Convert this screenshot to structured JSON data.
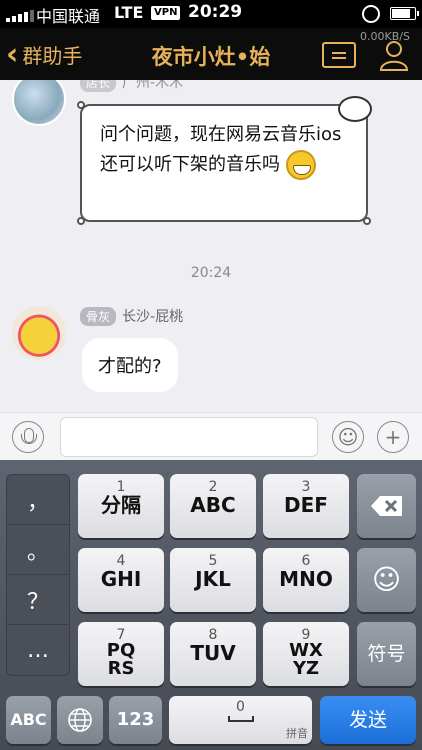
{
  "status": {
    "carrier": "中国联通",
    "network": "LTE",
    "vpn": "VPN",
    "time": "20:29",
    "speed": "0.00KB/S"
  },
  "nav": {
    "back_label": "群助手",
    "title": "夜市小灶•始"
  },
  "chat": {
    "msg1": {
      "sender_tag": "店长",
      "sender": "广州-木木",
      "text": "问个问题，现在网易云音乐ios还可以听下架的音乐吗"
    },
    "timestamp": "20:24",
    "msg2": {
      "sender_tag": "骨灰",
      "sender": "长沙-屁桃",
      "text": "才配的?"
    }
  },
  "input": {
    "placeholder": ""
  },
  "keyboard": {
    "side": [
      "，",
      "。",
      "？",
      "…"
    ],
    "keys": [
      {
        "num": "1",
        "label": "分隔"
      },
      {
        "num": "2",
        "label": "ABC"
      },
      {
        "num": "3",
        "label": "DEF"
      },
      {
        "num": "4",
        "label": "GHI"
      },
      {
        "num": "5",
        "label": "JKL"
      },
      {
        "num": "6",
        "label": "MNO"
      },
      {
        "num": "7",
        "label": "PQRS"
      },
      {
        "num": "8",
        "label": "TUV"
      },
      {
        "num": "9",
        "label": "WXYZ"
      }
    ],
    "symbols": "符号",
    "abc": "ABC",
    "num123": "123",
    "zero": "0",
    "pinyin": "拼音",
    "send": "发送"
  }
}
